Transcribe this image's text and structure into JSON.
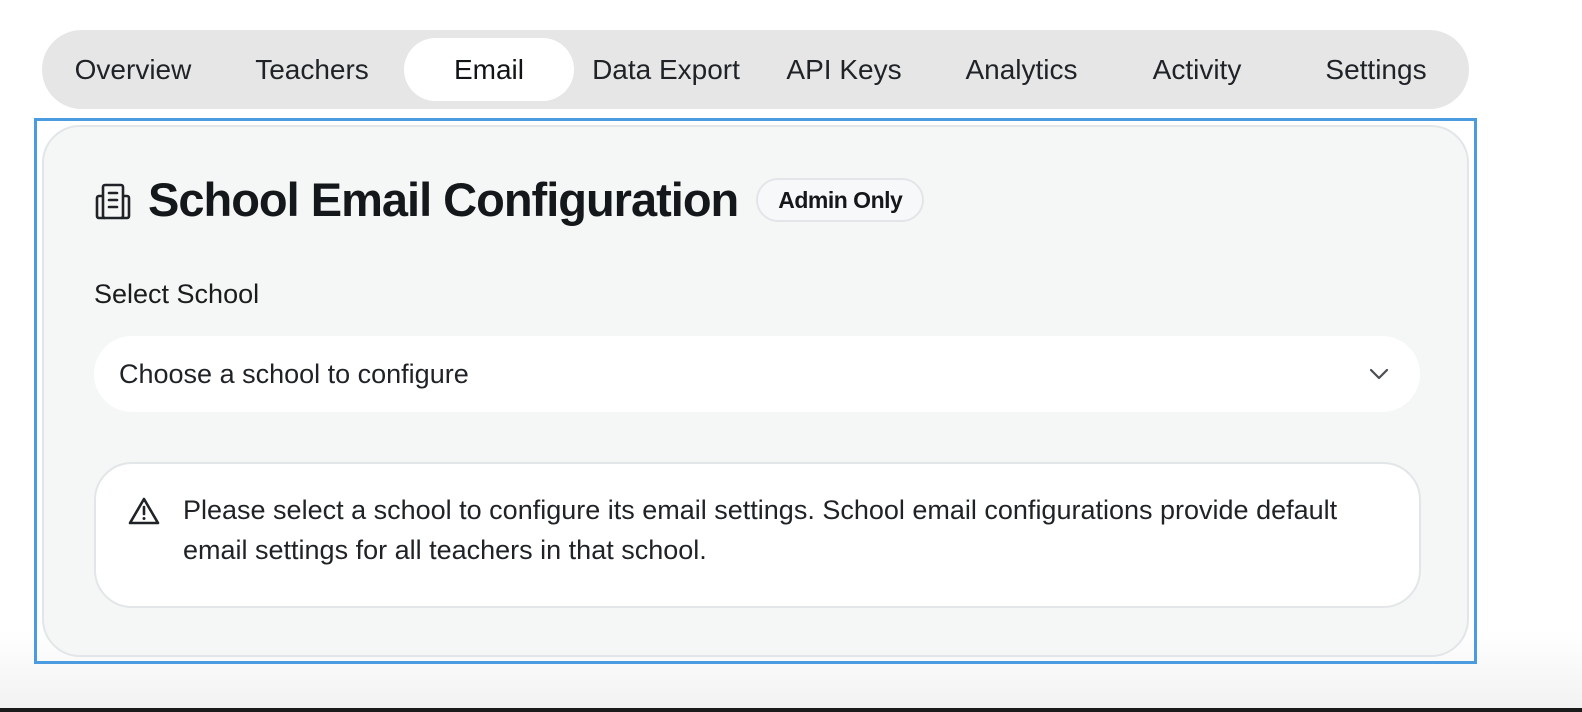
{
  "tabs": [
    {
      "label": "Overview",
      "active": false
    },
    {
      "label": "Teachers",
      "active": false
    },
    {
      "label": "Email",
      "active": true
    },
    {
      "label": "Data Export",
      "active": false
    },
    {
      "label": "API Keys",
      "active": false
    },
    {
      "label": "Analytics",
      "active": false
    },
    {
      "label": "Activity",
      "active": false
    },
    {
      "label": "Settings",
      "active": false
    }
  ],
  "card": {
    "icon": "document-icon",
    "title": "School Email Configuration",
    "badge": "Admin Only",
    "select_label": "Select School",
    "select_placeholder": "Choose a school to configure",
    "select_icon": "chevron-down-icon",
    "alert": {
      "icon": "warning-icon",
      "text": "Please select a school to configure its email settings. School email configurations provide default email settings for all teachers in that school."
    }
  },
  "colors": {
    "selection_outline": "#4a9be0",
    "tab_bar_bg": "#e6e6e6",
    "card_bg": "#f5f7f7"
  }
}
